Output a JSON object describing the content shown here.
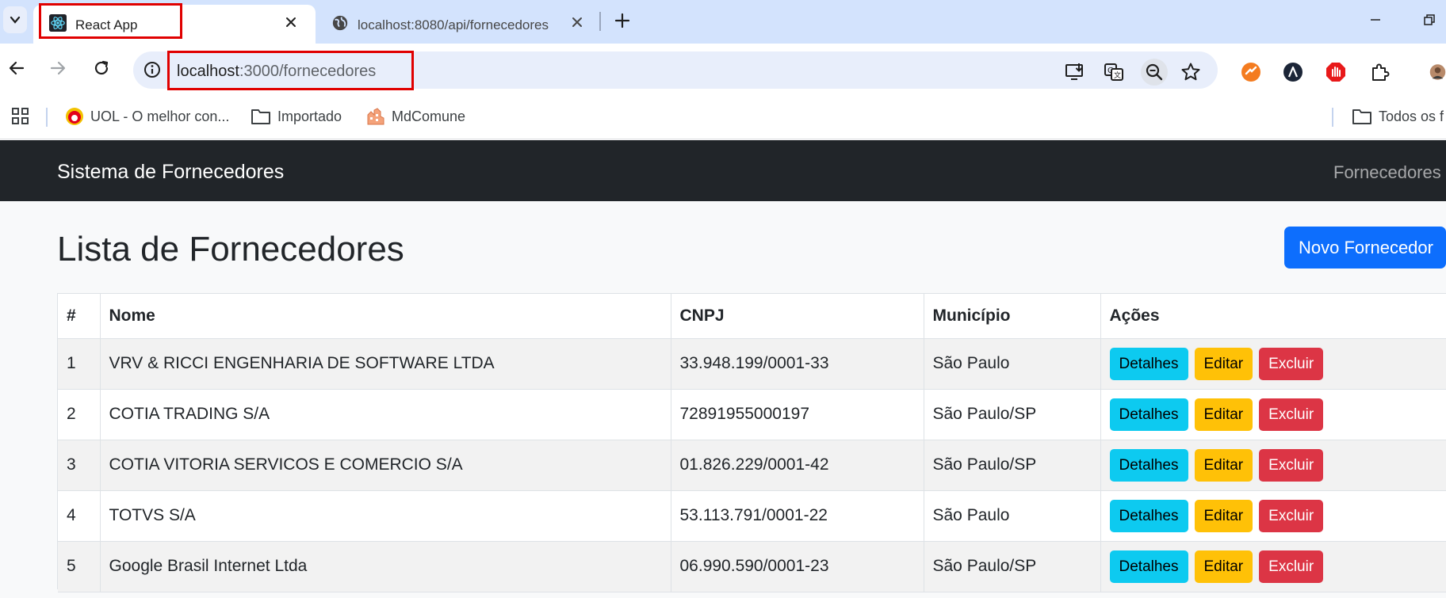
{
  "browser": {
    "tabs": [
      {
        "title": "React App",
        "active": true
      },
      {
        "title": "localhost:8080/api/fornecedores",
        "active": false
      }
    ],
    "address": {
      "host": "localhost",
      "path": ":3000/fornecedores"
    },
    "bookmarks": [
      {
        "label": "UOL - O melhor con...",
        "icon": "uol-icon"
      },
      {
        "label": "Importado",
        "icon": "folder-icon"
      },
      {
        "label": "MdComune",
        "icon": "mdcomune-icon"
      },
      {
        "label": "Todos os f",
        "icon": "folder-icon"
      }
    ],
    "highlight_color": "#e00000"
  },
  "app": {
    "brand": "Sistema de Fornecedores",
    "nav_link": "Fornecedores",
    "page_title": "Lista de Fornecedores",
    "new_button": "Novo Fornecedor",
    "table": {
      "headers": [
        "#",
        "Nome",
        "CNPJ",
        "Município",
        "Ações"
      ],
      "rows": [
        {
          "id": "1",
          "nome": "VRV & RICCI ENGENHARIA DE SOFTWARE LTDA",
          "cnpj": "33.948.199/0001-33",
          "municipio": "São Paulo"
        },
        {
          "id": "2",
          "nome": "COTIA TRADING S/A",
          "cnpj": "72891955000197",
          "municipio": "São Paulo/SP"
        },
        {
          "id": "3",
          "nome": "COTIA VITORIA SERVICOS E COMERCIO S/A",
          "cnpj": "01.826.229/0001-42",
          "municipio": "São Paulo/SP"
        },
        {
          "id": "4",
          "nome": "TOTVS S/A",
          "cnpj": "53.113.791/0001-22",
          "municipio": "São Paulo"
        },
        {
          "id": "5",
          "nome": "Google Brasil Internet Ltda",
          "cnpj": "06.990.590/0001-23",
          "municipio": "São Paulo/SP"
        }
      ],
      "actions": {
        "details": "Detalhes",
        "edit": "Editar",
        "delete": "Excluir"
      }
    },
    "colors": {
      "navbar": "#212529",
      "primary": "#0d6efd",
      "info": "#0dcaf0",
      "warning": "#ffc107",
      "danger": "#dc3545"
    }
  }
}
